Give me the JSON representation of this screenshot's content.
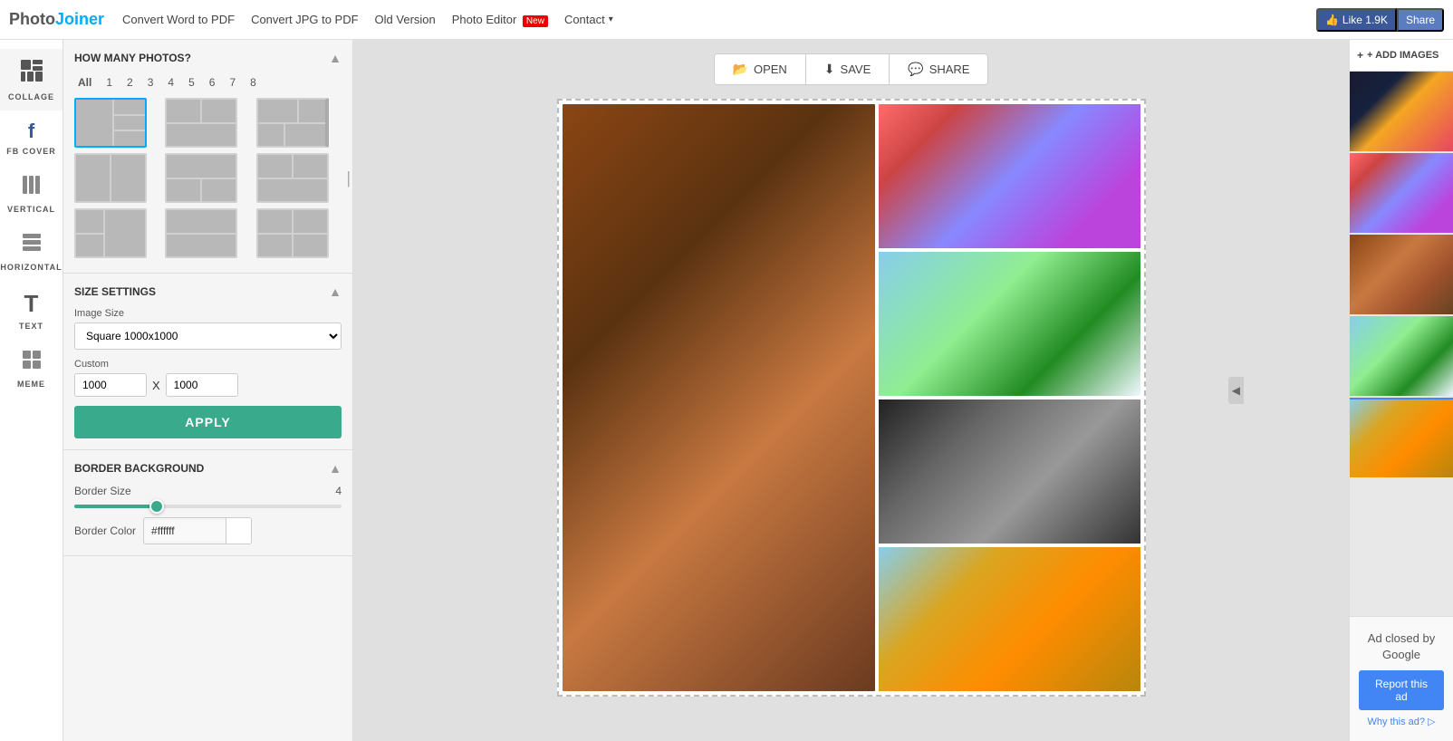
{
  "app": {
    "brand": {
      "photo": "Photo",
      "joiner": "Joiner"
    },
    "nav": {
      "links": [
        {
          "label": "Convert Word to PDF",
          "href": "#"
        },
        {
          "label": "Convert JPG to PDF",
          "href": "#"
        },
        {
          "label": "Old Version",
          "href": "#"
        },
        {
          "label": "Photo Editor",
          "href": "#",
          "badge": "New"
        },
        {
          "label": "Contact",
          "href": "#",
          "hasArrow": true
        }
      ]
    },
    "fb": {
      "like": "Like 1.9K",
      "share": "Share"
    }
  },
  "sidebar": {
    "items": [
      {
        "label": "COLLAGE",
        "icon": "⊞",
        "active": true
      },
      {
        "label": "FB COVER",
        "icon": "f"
      },
      {
        "label": "VERTICAL",
        "icon": "|||"
      },
      {
        "label": "HORIZONTAL",
        "icon": "≡"
      },
      {
        "label": "TEXT",
        "icon": "T"
      },
      {
        "label": "MEME",
        "icon": "⊡"
      }
    ]
  },
  "panel": {
    "how_many": {
      "title": "HOW MANY PHOTOS?",
      "counts": [
        "All",
        "1",
        "2",
        "3",
        "4",
        "5",
        "6",
        "7",
        "8"
      ]
    },
    "size_settings": {
      "title": "SIZE SETTINGS",
      "image_size_label": "Image Size",
      "image_size_value": "Square 1000x1000",
      "custom_label": "Custom",
      "width": "1000",
      "height": "1000",
      "x_label": "X",
      "apply_label": "APPLY"
    },
    "border": {
      "title": "BORDER BACKGROUND",
      "border_size_label": "Border Size",
      "border_size_value": "4",
      "border_color_label": "Border Color",
      "border_color_hex": "#ffffff"
    }
  },
  "toolbar": {
    "open_label": "OPEN",
    "save_label": "SAVE",
    "share_label": "SHARE"
  },
  "right_panel": {
    "add_images_label": "+ ADD IMAGES"
  },
  "ad": {
    "closed_text": "Ad closed by Google",
    "report_label": "Report this ad",
    "why_label": "Why this ad? ▷"
  }
}
